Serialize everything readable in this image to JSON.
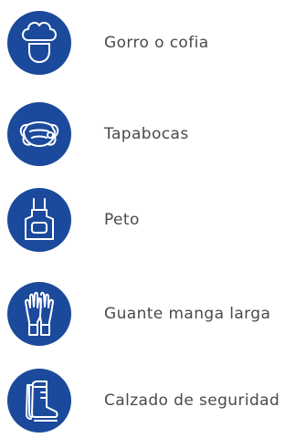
{
  "colors": {
    "icon_background": "#1b4a9c",
    "icon_stroke": "#ffffff",
    "text": "#4a4a4a"
  },
  "items": [
    {
      "label": "Gorro o cofia",
      "icon": "chef-hat-icon"
    },
    {
      "label": "Tapabocas",
      "icon": "face-mask-icon"
    },
    {
      "label": "Peto",
      "icon": "apron-icon"
    },
    {
      "label": "Guante manga larga",
      "icon": "long-gloves-icon"
    },
    {
      "label": "Calzado de seguridad",
      "icon": "safety-boots-icon"
    }
  ]
}
